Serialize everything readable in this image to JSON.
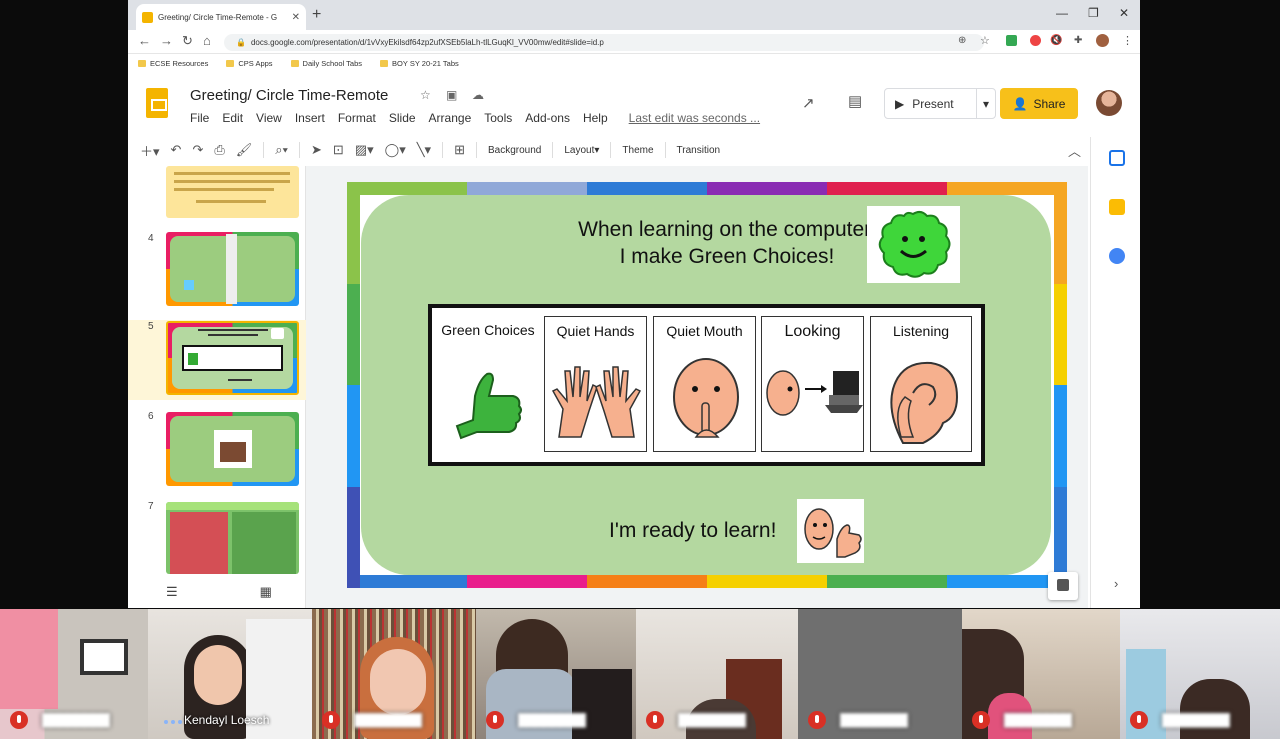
{
  "browser": {
    "tab_title": "Greeting/ Circle Time-Remote - G",
    "url": "docs.google.com/presentation/d/1vVxyEkilsdf64zp2ufXSEb5laLh-tlLGuqKl_VV00mw/edit#slide=id.p",
    "bookmarks": [
      "ECSE Resources",
      "CPS Apps",
      "Daily School Tabs",
      "BOY SY 20-21 Tabs"
    ]
  },
  "slides_app": {
    "doc_title": "Greeting/ Circle Time-Remote",
    "menus": [
      "File",
      "Edit",
      "View",
      "Insert",
      "Format",
      "Slide",
      "Arrange",
      "Tools",
      "Add-ons",
      "Help"
    ],
    "last_edit": "Last edit was seconds ...",
    "present_label": "Present",
    "share_label": "Share",
    "toolbar": {
      "background": "Background",
      "layout": "Layout",
      "theme": "Theme",
      "transition": "Transition"
    }
  },
  "filmstrip": {
    "slide_numbers": [
      "4",
      "5",
      "6",
      "7"
    ],
    "selected": "5"
  },
  "slide": {
    "title_line1": "When learning on the computer,",
    "title_line2": "I make Green Choices!",
    "cards": [
      "Green Choices",
      "Quiet Hands",
      "Quiet Mouth",
      "Looking",
      "Listening"
    ],
    "footer": "I'm ready to learn!"
  },
  "participants": {
    "visible_name": "Kendayl Loesch"
  },
  "colors": {
    "share_button": "#f7c01a",
    "slide_green": "#b4d8a0",
    "mute_red": "#d93025"
  }
}
